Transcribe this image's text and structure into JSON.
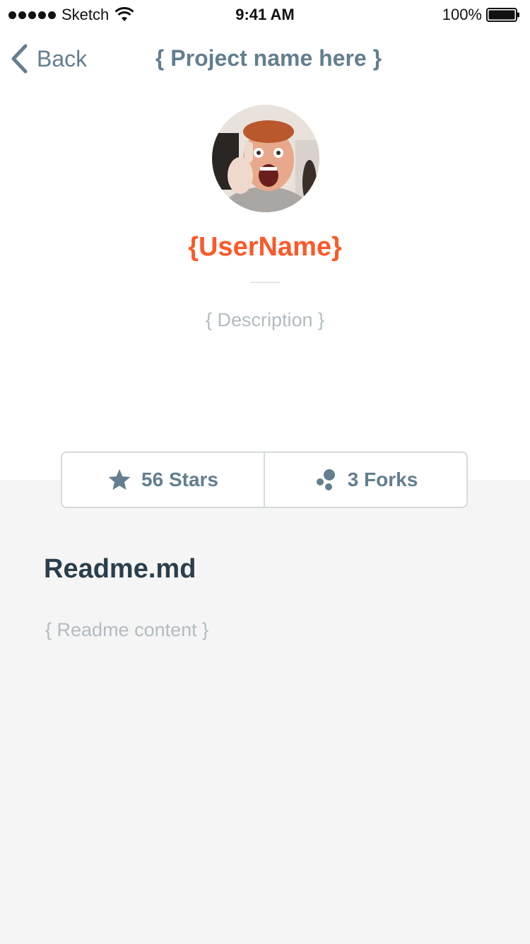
{
  "status_bar": {
    "carrier": "Sketch",
    "time": "9:41 AM",
    "battery": "100%"
  },
  "nav": {
    "back_label": "Back",
    "title": "{ Project name here }"
  },
  "profile": {
    "username": "{UserName}",
    "description": "{ Description }"
  },
  "stats": {
    "stars_label": "56 Stars",
    "forks_label": "3 Forks"
  },
  "readme": {
    "title": "Readme.md",
    "content": "{ Readme content }"
  },
  "colors": {
    "accent": "#fa5a2a",
    "nav_text": "#637f8f",
    "heading": "#2b3e4c",
    "muted": "#b3bcc2",
    "section_bg": "#f5f5f5"
  }
}
